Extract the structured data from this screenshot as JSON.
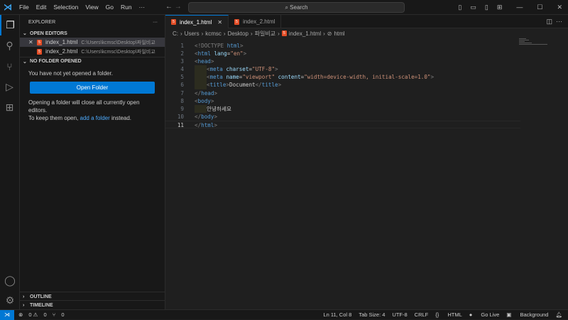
{
  "menu": [
    "File",
    "Edit",
    "Selection",
    "View",
    "Go",
    "Run",
    "···"
  ],
  "search_label": "Search",
  "explorer": {
    "title": "EXPLORER",
    "more": "···",
    "open_editors_label": "OPEN EDITORS",
    "open_editors": [
      {
        "name": "index_1.html",
        "path": "C:\\Users\\kcmsc\\Desktop\\파일비교",
        "selected": true
      },
      {
        "name": "index_2.html",
        "path": "C:\\Users\\kcmsc\\Desktop\\파일비교",
        "selected": false
      }
    ],
    "no_folder_label": "NO FOLDER OPENED",
    "no_folder_msg": "You have not yet opened a folder.",
    "open_folder_button": "Open Folder",
    "info_line1": "Opening a folder will close all currently open editors.",
    "info_line2_pre": "To keep them open, ",
    "info_link": "add a folder",
    "info_line2_post": " instead.",
    "outline_label": "OUTLINE",
    "timeline_label": "TIMELINE"
  },
  "tabs": [
    {
      "label": "index_1.html",
      "active": true
    },
    {
      "label": "index_2.html",
      "active": false
    }
  ],
  "breadcrumb": [
    "C:",
    "Users",
    "kcmsc",
    "Desktop",
    "파일비교",
    "index_1.html",
    "html"
  ],
  "code": {
    "current_line": 11,
    "lines": [
      [
        [
          "<!DOCTYPE ",
          "br"
        ],
        [
          "html",
          "tag"
        ],
        [
          ">",
          "br"
        ]
      ],
      [
        [
          "<",
          "br"
        ],
        [
          "html ",
          "tag"
        ],
        [
          "lang",
          "attr"
        ],
        [
          "=",
          "t"
        ],
        [
          "\"en\"",
          "str"
        ],
        [
          ">",
          "br"
        ]
      ],
      [
        [
          "<",
          "br"
        ],
        [
          "head",
          "tag"
        ],
        [
          ">",
          "br"
        ]
      ],
      [
        [
          "IND",
          ""
        ],
        [
          "<",
          "br"
        ],
        [
          "meta ",
          "tag"
        ],
        [
          "charset",
          "attr"
        ],
        [
          "=",
          "t"
        ],
        [
          "\"UTF-8\"",
          "str"
        ],
        [
          ">",
          "br"
        ]
      ],
      [
        [
          "IND",
          ""
        ],
        [
          "<",
          "br"
        ],
        [
          "meta ",
          "tag"
        ],
        [
          "name",
          "attr"
        ],
        [
          "=",
          "t"
        ],
        [
          "\"viewport\" ",
          "str"
        ],
        [
          "content",
          "attr"
        ],
        [
          "=",
          "t"
        ],
        [
          "\"width=device-width, initial-scale=1.0\"",
          "str"
        ],
        [
          ">",
          "br"
        ]
      ],
      [
        [
          "IND",
          ""
        ],
        [
          "<",
          "br"
        ],
        [
          "title",
          "tag"
        ],
        [
          ">",
          "br"
        ],
        [
          "Document",
          "t"
        ],
        [
          "</",
          "br"
        ],
        [
          "title",
          "tag"
        ],
        [
          ">",
          "br"
        ]
      ],
      [
        [
          "</",
          "br"
        ],
        [
          "head",
          "tag"
        ],
        [
          ">",
          "br"
        ]
      ],
      [
        [
          "<",
          "br"
        ],
        [
          "body",
          "tag"
        ],
        [
          ">",
          "br"
        ]
      ],
      [
        [
          "IND",
          ""
        ],
        [
          "안녕하세요",
          "t"
        ]
      ],
      [
        [
          "</",
          "br"
        ],
        [
          "body",
          "tag"
        ],
        [
          ">",
          "br"
        ]
      ],
      [
        [
          "</",
          "br"
        ],
        [
          "html",
          "tag"
        ],
        [
          ">",
          "br"
        ]
      ]
    ]
  },
  "status": {
    "errors": "0",
    "warnings": "0",
    "ports": "0",
    "position": "Ln 11, Col 8",
    "tab_size": "Tab Size: 4",
    "encoding": "UTF-8",
    "eol": "CRLF",
    "language": "HTML",
    "go_live": "Go Live",
    "background": "Background"
  }
}
